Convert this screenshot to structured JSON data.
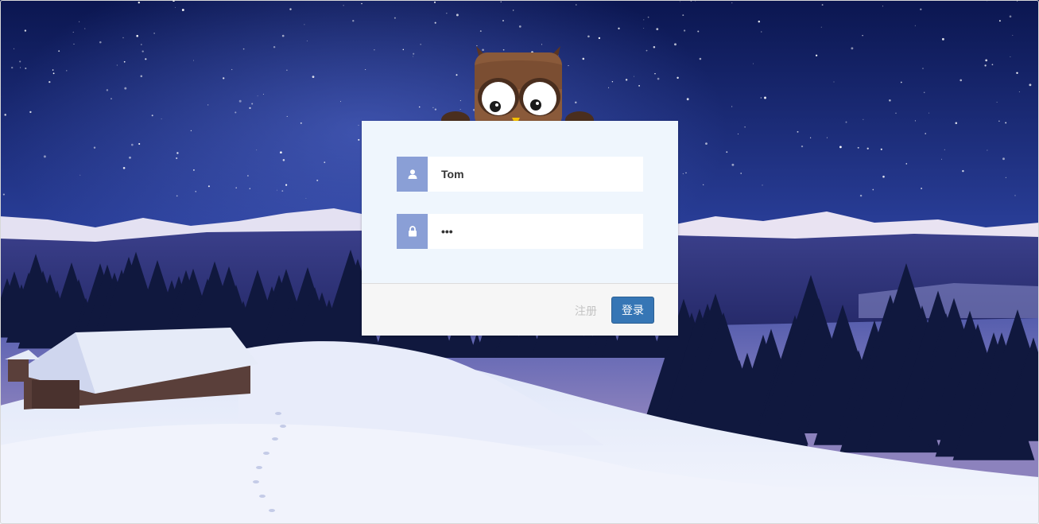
{
  "login": {
    "username_value": "Tom",
    "password_value": "•••",
    "register_label": "注册",
    "login_label": "登录"
  },
  "icons": {
    "username": "user-icon",
    "password": "lock-icon",
    "mascot": "owl-mascot"
  },
  "colors": {
    "icon_bg": "#8a9fd6",
    "panel_bg": "#eff6fd",
    "footer_bg": "#f6f6f6",
    "login_button": "#3676b5",
    "register_link": "#c4c4c4"
  }
}
